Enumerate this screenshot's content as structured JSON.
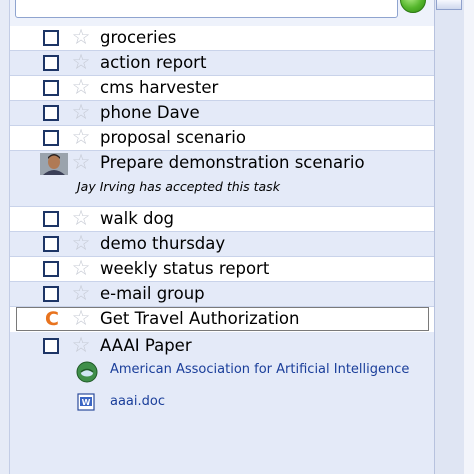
{
  "colors": {
    "accent": "#e8731e",
    "link": "#1a3e9a",
    "row_shade": "#e4eaf8",
    "add_button": "#55b62c"
  },
  "search": {
    "placeholder": ""
  },
  "tasks": [
    {
      "label": "groceries",
      "icon": "checkbox",
      "starred": false
    },
    {
      "label": "action report",
      "icon": "checkbox",
      "starred": false
    },
    {
      "label": "cms harvester",
      "icon": "checkbox",
      "starred": false
    },
    {
      "label": "phone Dave",
      "icon": "checkbox",
      "starred": false
    },
    {
      "label": "proposal scenario",
      "icon": "checkbox",
      "starred": false
    },
    {
      "label": "Prepare demonstration scenario",
      "icon": "avatar",
      "starred": false,
      "note": "Jay Irving has accepted this task"
    },
    {
      "label": "walk dog",
      "icon": "checkbox",
      "starred": false
    },
    {
      "label": "demo thursday",
      "icon": "checkbox",
      "starred": false
    },
    {
      "label": "weekly status report",
      "icon": "checkbox",
      "starred": false
    },
    {
      "label": "e-mail group",
      "icon": "checkbox",
      "starred": false
    },
    {
      "label": "Get Travel Authorization",
      "icon": "c-mark",
      "starred": false
    },
    {
      "label": "AAAI Paper",
      "icon": "checkbox",
      "starred": false,
      "attachments": [
        {
          "icon": "web-link-icon",
          "text": "American Association for Artificial Intelligence"
        },
        {
          "icon": "word-document-icon",
          "text": "aaai.doc"
        }
      ]
    }
  ],
  "c_mark_glyph": "C",
  "star_glyph": "☆"
}
